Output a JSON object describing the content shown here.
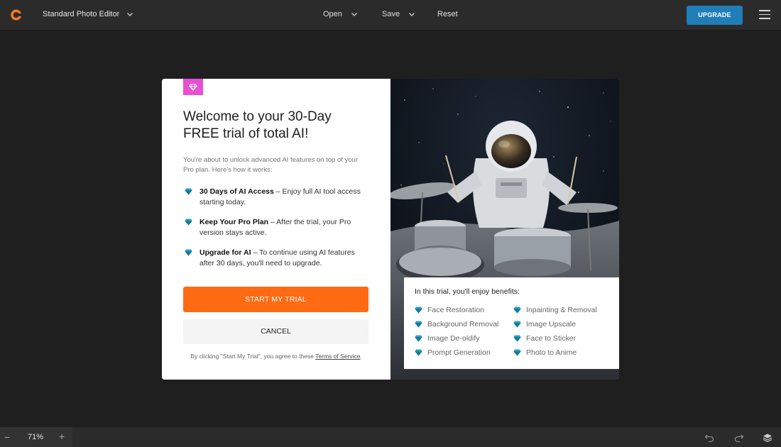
{
  "topbar": {
    "app_title": "Standard Photo Editor",
    "menu": {
      "open": "Open",
      "save": "Save",
      "reset": "Reset"
    },
    "upgrade_label": "UPGRADE"
  },
  "modal": {
    "title": "Welcome to your 30-Day FREE trial of total AI!",
    "intro": "You're about to unlock advanced AI features on top of your Pro plan. Here's how it works:",
    "features": [
      {
        "bold": "30 Days of AI Access",
        "rest": " – Enjoy full AI tool access starting today."
      },
      {
        "bold": "Keep Your Pro Plan",
        "rest": " – After the trial, your Pro version stays active."
      },
      {
        "bold": "Upgrade for AI",
        "rest": " – To continue using AI features after 30 days, you'll need to upgrade."
      }
    ],
    "start_label": "START MY TRIAL",
    "cancel_label": "CANCEL",
    "tos_prefix": "By clicking \"Start My Trial\", you agree to these ",
    "tos_link": "Terms of Service",
    "tos_suffix": ".",
    "benefits_title": "In this trial, you'll enjoy benefits:",
    "benefits": [
      "Face Restoration",
      "Inpainting & Removal",
      "Background Removal",
      "Image Upscale",
      "Image De-oldify",
      "Face to Sticker",
      "Prompt Generation",
      "Photo to Anime"
    ]
  },
  "bottombar": {
    "zoom": "71%"
  },
  "colors": {
    "accent_orange": "#ff6a13",
    "upgrade_blue": "#1f7db8",
    "gem_teal": "#1f8fb0",
    "badge_pink": "#e84fd3"
  }
}
